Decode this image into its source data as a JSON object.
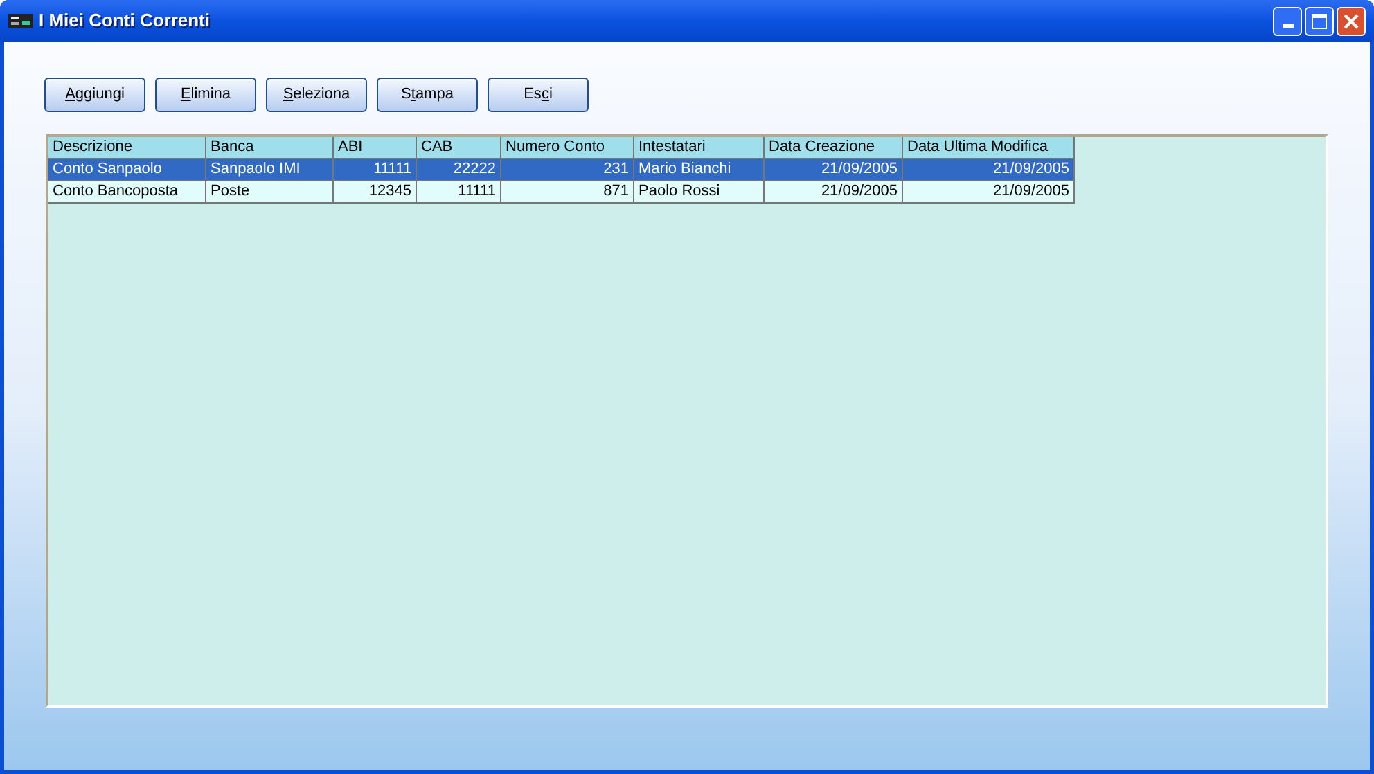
{
  "window": {
    "title": "I Miei Conti Correnti"
  },
  "buttons": [
    {
      "key": "A",
      "after": "ggiungi"
    },
    {
      "key": "E",
      "after": "limina"
    },
    {
      "key": "S",
      "after": "eleziona"
    },
    {
      "before": "S",
      "key": "t",
      "after": "ampa"
    },
    {
      "before": "Es",
      "key": "c",
      "after": "i"
    }
  ],
  "table": {
    "columns": [
      {
        "label": "Descrizione",
        "kind": "text"
      },
      {
        "label": "Banca",
        "kind": "text"
      },
      {
        "label": "ABI",
        "kind": "number"
      },
      {
        "label": "CAB",
        "kind": "number"
      },
      {
        "label": "Numero Conto",
        "kind": "number"
      },
      {
        "label": "Intestatari",
        "kind": "text"
      },
      {
        "label": "Data Creazione",
        "kind": "number"
      },
      {
        "label": "Data Ultima Modifica",
        "kind": "number"
      }
    ],
    "rows": [
      {
        "selected": true,
        "cells": [
          "Conto Sanpaolo",
          "Sanpaolo IMI",
          "11111",
          "22222",
          "231",
          "Mario Bianchi",
          "21/09/2005",
          "21/09/2005"
        ]
      },
      {
        "selected": false,
        "cells": [
          "Conto Bancoposta",
          "Poste",
          "12345",
          "11111",
          "871",
          "Paolo Rossi",
          "21/09/2005",
          "21/09/2005"
        ]
      }
    ]
  }
}
